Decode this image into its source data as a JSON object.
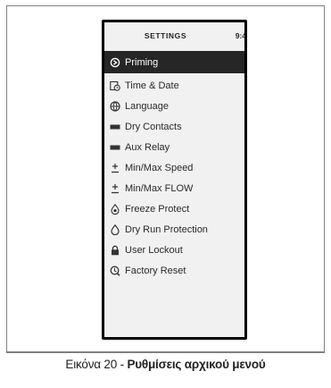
{
  "header": {
    "title": "SETTINGS",
    "time": "9:4"
  },
  "menu": [
    {
      "label": "Priming",
      "icon": "priming-icon",
      "selected": true
    },
    {
      "label": "Time & Date",
      "icon": "calendar-clock-icon",
      "selected": false
    },
    {
      "label": "Language",
      "icon": "globe-icon",
      "selected": false
    },
    {
      "label": "Dry Contacts",
      "icon": "terminal-block-icon",
      "selected": false
    },
    {
      "label": "Aux Relay",
      "icon": "relay-icon",
      "selected": false
    },
    {
      "label": "Min/Max Speed",
      "icon": "plus-minus-icon",
      "selected": false
    },
    {
      "label": "Min/Max FLOW",
      "icon": "plus-minus-icon",
      "selected": false
    },
    {
      "label": "Freeze Protect",
      "icon": "drop-icon",
      "selected": false
    },
    {
      "label": "Dry Run Protection",
      "icon": "drop-outline-icon",
      "selected": false
    },
    {
      "label": "User Lockout",
      "icon": "lock-icon",
      "selected": false
    },
    {
      "label": "Factory Reset",
      "icon": "reset-icon",
      "selected": false
    }
  ],
  "caption": {
    "prefix": "Εικόνα 20 - ",
    "bold": "Ρυθμίσεις αρχικού μενού"
  },
  "colors": {
    "selected_bg": "#262626",
    "screen_bg": "#f1f1f1",
    "bezel": "#000000"
  }
}
